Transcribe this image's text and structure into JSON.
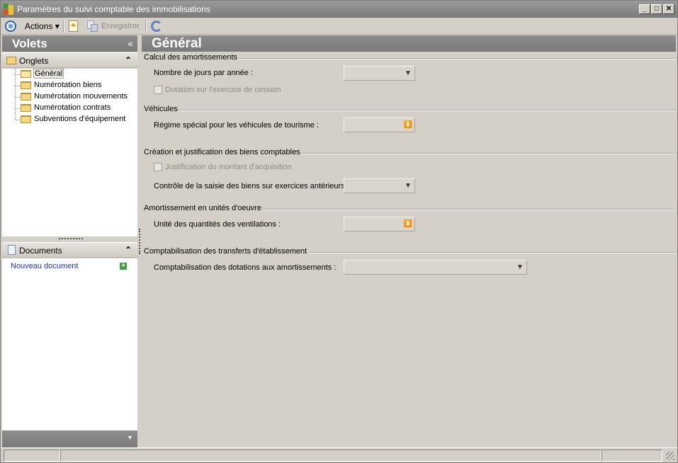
{
  "window": {
    "title": "Paramètres du suivi comptable des immobilisations"
  },
  "controls": {
    "minimize": "_",
    "maximize": "□",
    "close": "✕"
  },
  "toolbar": {
    "actions_label": "Actions",
    "actions_caret": "▾",
    "save_label": "Enregistrer",
    "icons": [
      "globe-icon",
      "new-document-icon",
      "save-icon",
      "refresh-icon"
    ]
  },
  "left_pane": {
    "title": "Volets",
    "collapse_glyph": "«",
    "tabs_section": {
      "label": "Onglets",
      "chevron": "⌃",
      "items": [
        {
          "label": "Général",
          "selected": true
        },
        {
          "label": "Numérotation biens"
        },
        {
          "label": "Numérotation mouvements"
        },
        {
          "label": "Numérotation contrats"
        },
        {
          "label": "Subventions d'équipement"
        }
      ]
    },
    "documents_section": {
      "label": "Documents",
      "chevron": "⌃",
      "new_document_link": "Nouveau document",
      "add_glyph": "+"
    },
    "footer_chevron": "▾"
  },
  "main": {
    "title": "Général",
    "groups": [
      {
        "title": "Calcul des amortissements",
        "fields": [
          {
            "type": "combo",
            "label": "Nombre de jours par année :",
            "value": "",
            "enabled": false
          },
          {
            "type": "checkbox",
            "label": "Dotation sur l'exercice de cession",
            "checked": false,
            "enabled": false
          }
        ]
      },
      {
        "title": "Véhicules",
        "fields": [
          {
            "type": "combo",
            "label": "Régime spécial pour les véhicules de tourisme :",
            "value": "",
            "enabled": false
          }
        ]
      },
      {
        "title": "Création et justification des biens comptables",
        "fields": [
          {
            "type": "checkbox",
            "label": "Justification du montant d'acquisition",
            "checked": false,
            "enabled": false
          },
          {
            "type": "combo",
            "label": "Contrôle de la saisie des biens sur exercices antérieurs :",
            "value": "",
            "enabled": false
          }
        ]
      },
      {
        "title": "Amortissement en unités d'oeuvre",
        "fields": [
          {
            "type": "combo",
            "label": "Unité des quantités des ventilations :",
            "value": "",
            "enabled": false
          }
        ]
      },
      {
        "title": "Comptabilisation des transferts d'établissement",
        "fields": [
          {
            "type": "combo",
            "label": "Comptabilisation des dotations aux amortissements :",
            "value": "",
            "enabled": false
          }
        ]
      }
    ]
  },
  "colors": {
    "header_gray": "#808080",
    "window_bg": "#d4d0c8",
    "link_blue": "#1a2fd0",
    "selected_item_bg": "#e8e6e0"
  }
}
